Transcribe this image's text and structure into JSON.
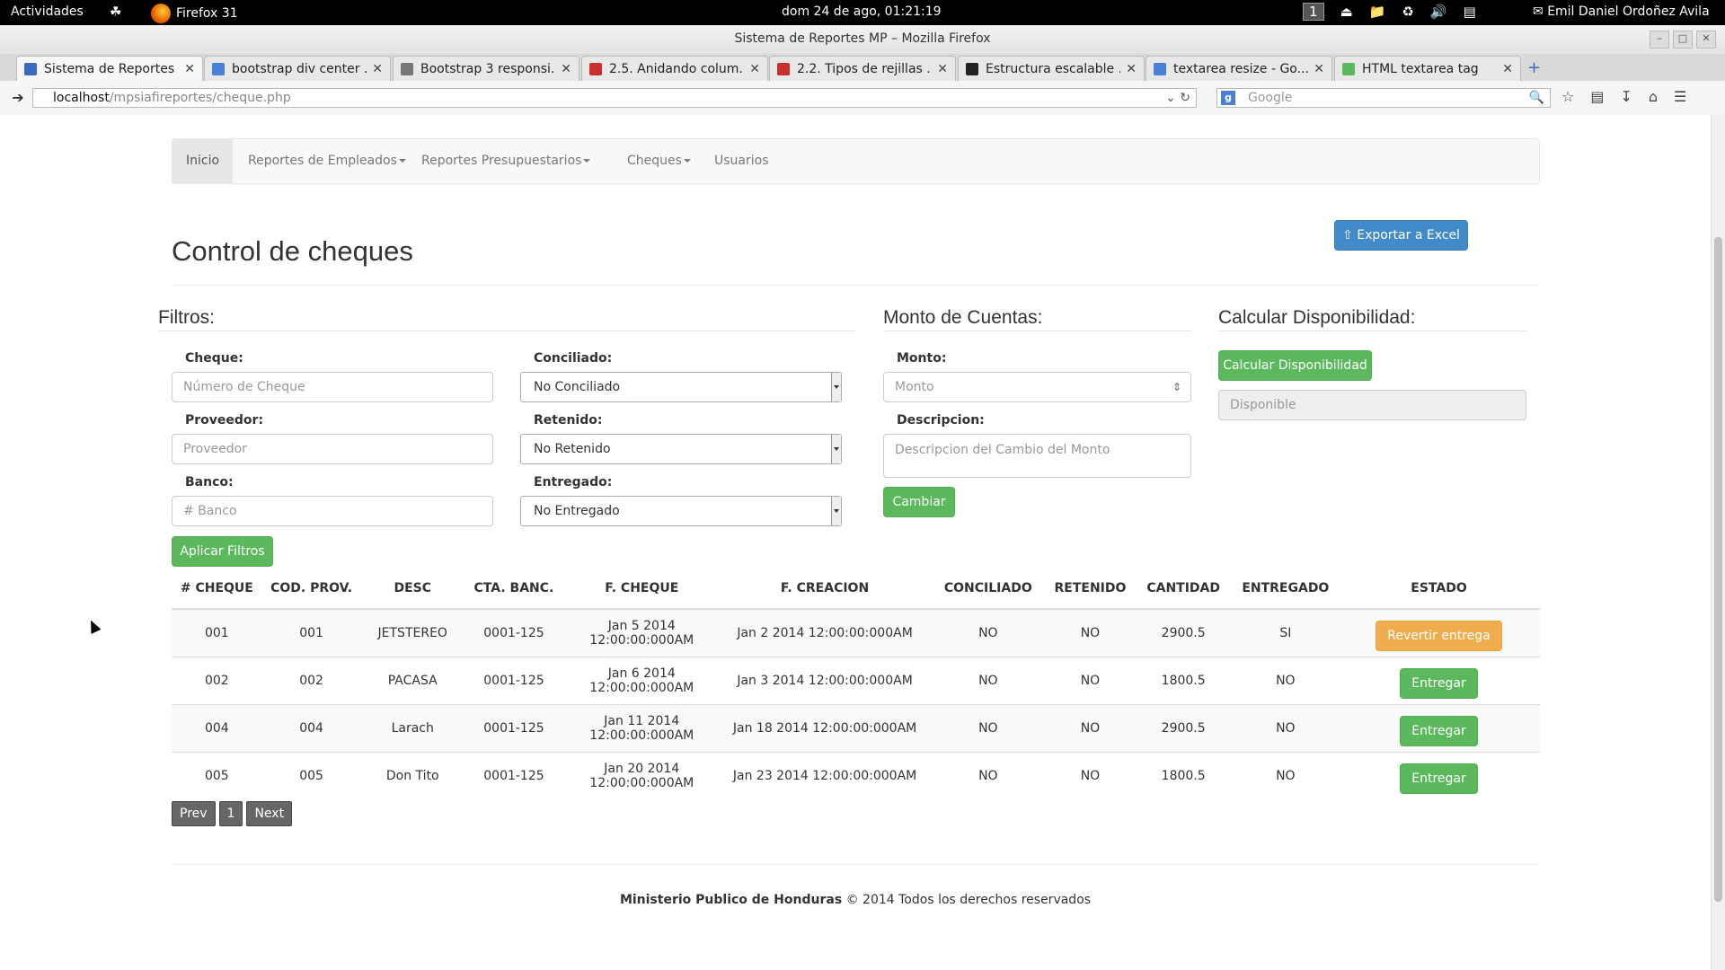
{
  "desktop": {
    "activities": "Actividades",
    "app_name": "Firefox 31",
    "clock": "dom 24 de ago, 01:21:19",
    "workspace": "1",
    "user": "Emil Daniel Ordoñez Avila"
  },
  "window": {
    "title": "Sistema de Reportes MP – Mozilla Firefox"
  },
  "tabs": [
    {
      "title": "Sistema de Reportes ...",
      "icon": "mp-favicon-icon",
      "color": "#3a6bc1"
    },
    {
      "title": "bootstrap div center ...",
      "icon": "google-favicon-icon",
      "color": "#4a7fd6"
    },
    {
      "title": "Bootstrap 3 responsi...",
      "icon": "stackexchange-favicon-icon",
      "color": "#777777"
    },
    {
      "title": "2.5. Anidando colum...",
      "icon": "book-favicon-icon",
      "color": "#c9302c"
    },
    {
      "title": "2.2. Tipos de rejillas ...",
      "icon": "book-favicon-icon",
      "color": "#c9302c"
    },
    {
      "title": "Estructura escalable ...",
      "icon": "bootstrap-favicon-icon",
      "color": "#222222"
    },
    {
      "title": "textarea resize - Go...",
      "icon": "google-favicon-icon",
      "color": "#4a7fd6"
    },
    {
      "title": "HTML textarea tag",
      "icon": "w3schools-favicon-icon",
      "color": "#5cb85c"
    }
  ],
  "browser": {
    "url_host": "localhost",
    "url_path": "/mpsiafireportes/cheque.php",
    "search_placeholder": "Google"
  },
  "nav": {
    "items": [
      "Inicio",
      "Reportes de Empleados",
      "Reportes Presupuestarios",
      "Cheques",
      "Usuarios"
    ]
  },
  "page": {
    "title": "Control de cheques",
    "export_button": "Exportar a Excel"
  },
  "filters": {
    "legend": "Filtros:",
    "cheque_label": "Cheque:",
    "cheque_placeholder": "Número de Cheque",
    "proveedor_label": "Proveedor:",
    "proveedor_placeholder": "Proveedor",
    "banco_label": "Banco:",
    "banco_placeholder": "# Banco",
    "conciliado_label": "Conciliado:",
    "conciliado_value": "No Conciliado",
    "retenido_label": "Retenido:",
    "retenido_value": "No Retenido",
    "entregado_label": "Entregado:",
    "entregado_value": "No Entregado",
    "apply_button": "Aplicar Filtros"
  },
  "montos": {
    "legend": "Monto de Cuentas:",
    "monto_label": "Monto:",
    "monto_placeholder": "Monto",
    "descripcion_label": "Descripcion:",
    "descripcion_placeholder": "Descripcion del Cambio del Monto",
    "cambiar_button": "Cambiar"
  },
  "disponibilidad": {
    "legend": "Calcular Disponibilidad:",
    "calc_button": "Calcular Disponibilidad",
    "disponible_placeholder": "Disponible"
  },
  "table": {
    "headers": [
      "# CHEQUE",
      "COD. PROV.",
      "DESC",
      "CTA. BANC.",
      "F. CHEQUE",
      "F. CREACION",
      "CONCILIADO",
      "RETENIDO",
      "CANTIDAD",
      "ENTREGADO",
      "ESTADO"
    ],
    "rows": [
      {
        "cheque": "001",
        "prov": "001",
        "desc": "JETSTEREO",
        "cta": "0001-125",
        "fcheque": "Jan 5 2014 12:00:00:000AM",
        "fcreacion": "Jan 2 2014 12:00:00:000AM",
        "conciliado": "NO",
        "retenido": "NO",
        "cantidad": "2900.5",
        "entregado": "SI",
        "action": "Revertir entrega"
      },
      {
        "cheque": "002",
        "prov": "002",
        "desc": "PACASA",
        "cta": "0001-125",
        "fcheque": "Jan 6 2014 12:00:00:000AM",
        "fcreacion": "Jan 3 2014 12:00:00:000AM",
        "conciliado": "NO",
        "retenido": "NO",
        "cantidad": "1800.5",
        "entregado": "NO",
        "action": "Entregar"
      },
      {
        "cheque": "004",
        "prov": "004",
        "desc": "Larach",
        "cta": "0001-125",
        "fcheque": "Jan 11 2014 12:00:00:000AM",
        "fcreacion": "Jan 18 2014 12:00:00:000AM",
        "conciliado": "NO",
        "retenido": "NO",
        "cantidad": "2900.5",
        "entregado": "NO",
        "action": "Entregar"
      },
      {
        "cheque": "005",
        "prov": "005",
        "desc": "Don Tito",
        "cta": "0001-125",
        "fcheque": "Jan 20 2014 12:00:00:000AM",
        "fcreacion": "Jan 23 2014 12:00:00:000AM",
        "conciliado": "NO",
        "retenido": "NO",
        "cantidad": "1800.5",
        "entregado": "NO",
        "action": "Entregar"
      }
    ]
  },
  "pagination": {
    "prev": "Prev",
    "page": "1",
    "next": "Next"
  },
  "footer": {
    "org": "Ministerio Publico de Honduras",
    "rights": "© 2014 Todos los derechos reservados"
  }
}
